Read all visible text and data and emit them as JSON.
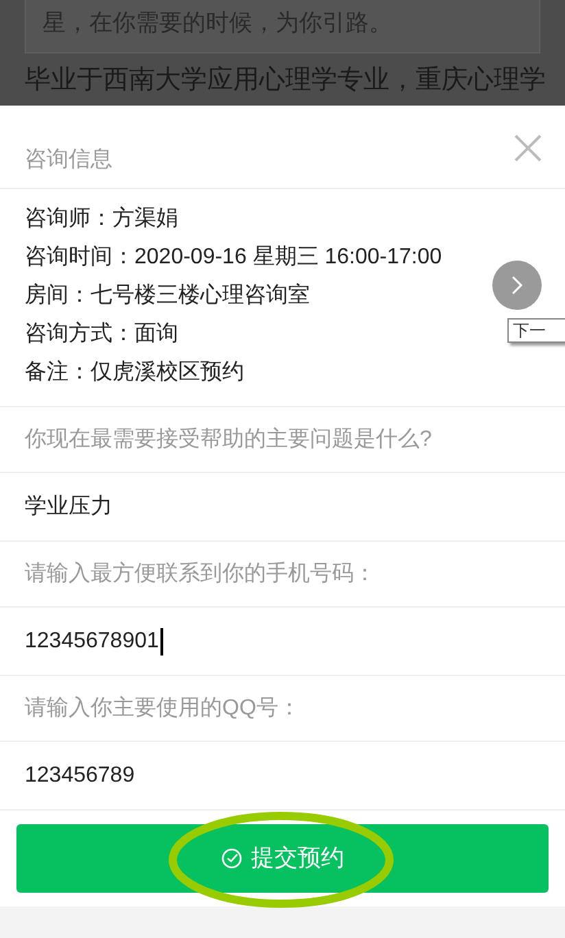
{
  "background": {
    "quote": "星，在你需要的时候，为你引路。",
    "text": "毕业于西南大学应用心理学专业，重庆心理学"
  },
  "sheet": {
    "title": "咨询信息",
    "info": [
      "咨询师：方渠娟",
      "咨询时间：2020-09-16 星期三 16:00-17:00",
      "房间：七号楼三楼心理咨询室",
      "咨询方式：面询",
      "备注：仅虎溪校区预约"
    ],
    "next_tooltip": "下一",
    "fields": [
      {
        "label": "你现在最需要接受帮助的主要问题是什么?",
        "value": "学业压力",
        "focused": false
      },
      {
        "label": "请输入最方便联系到你的手机号码：",
        "value": "12345678901",
        "focused": true
      },
      {
        "label": "请输入你主要使用的QQ号：",
        "value": "123456789",
        "focused": false
      }
    ],
    "submit": "提交预约"
  }
}
